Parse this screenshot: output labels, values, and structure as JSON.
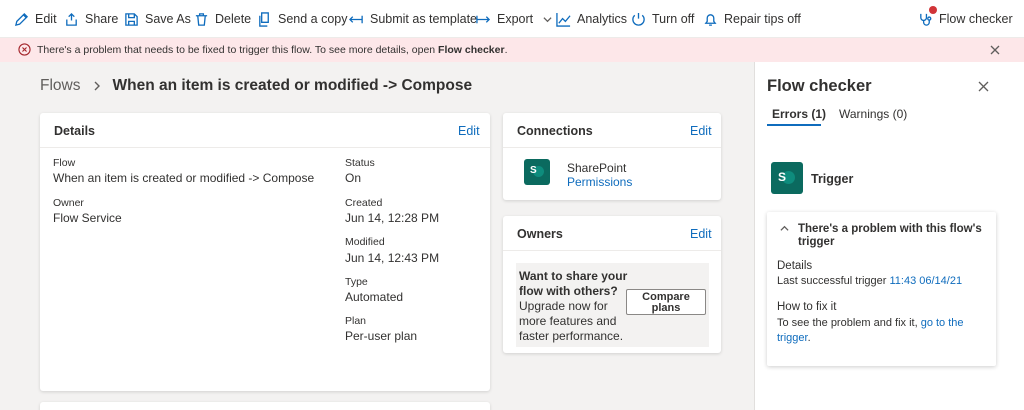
{
  "toolbar": {
    "items": [
      {
        "label": "Edit",
        "icon": "pencil-icon"
      },
      {
        "label": "Share",
        "icon": "share-icon"
      },
      {
        "label": "Save As",
        "icon": "save-as-icon"
      },
      {
        "label": "Delete",
        "icon": "trash-icon"
      },
      {
        "label": "Send a copy",
        "icon": "copy-icon"
      },
      {
        "label": "Submit as template",
        "icon": "submit-template-icon"
      },
      {
        "label": "Export",
        "icon": "export-icon"
      },
      {
        "label": "Analytics",
        "icon": "analytics-icon"
      },
      {
        "label": "Turn off",
        "icon": "power-icon"
      },
      {
        "label": "Repair tips off",
        "icon": "bell-icon"
      },
      {
        "label": "Flow checker",
        "icon": "stethoscope-icon"
      }
    ],
    "accent": "#0f6cbd",
    "notification_color": "#d13438"
  },
  "banner": {
    "text": "There's a problem that needs to be fixed to trigger this flow. To see more details, open",
    "link": "Flow checker",
    "trailing": ".",
    "background": "#fde7e9"
  },
  "breadcrumb": {
    "root": "Flows",
    "current": "When an item is created or modified -> Compose"
  },
  "details": {
    "title": "Details",
    "edit": "Edit",
    "flow_label": "Flow",
    "flow_value": "When an item is created or modified -> Compose",
    "owner_label": "Owner",
    "owner_value": "Flow Service",
    "status_label": "Status",
    "status_value": "On",
    "created_label": "Created",
    "created_value": "Jun 14, 12:28 PM",
    "modified_label": "Modified",
    "modified_value": "Jun 14, 12:43 PM",
    "type_label": "Type",
    "type_value": "Automated",
    "plan_label": "Plan",
    "plan_value": "Per-user plan"
  },
  "connections": {
    "title": "Connections",
    "edit": "Edit",
    "name": "SharePoint",
    "permissions": "Permissions"
  },
  "owners": {
    "title": "Owners",
    "edit": "Edit",
    "promo_bold": "Want to share your flow with others?",
    "promo_text": "Upgrade now for more features and faster performance.",
    "button": "Compare plans"
  },
  "flow_checker": {
    "title": "Flow checker",
    "tab_errors": "Errors (1)",
    "tab_warnings": "Warnings (0)",
    "trigger_label": "Trigger",
    "problem_title": "There's a problem with this flow's trigger",
    "details_label": "Details",
    "last_trigger_text": "Last successful trigger",
    "last_trigger_link": "11:43 06/14/21",
    "howto_label": "How to fix it",
    "howto_text": "To see the problem and fix it,",
    "howto_link": "go to the trigger",
    "howto_trailing": "."
  }
}
